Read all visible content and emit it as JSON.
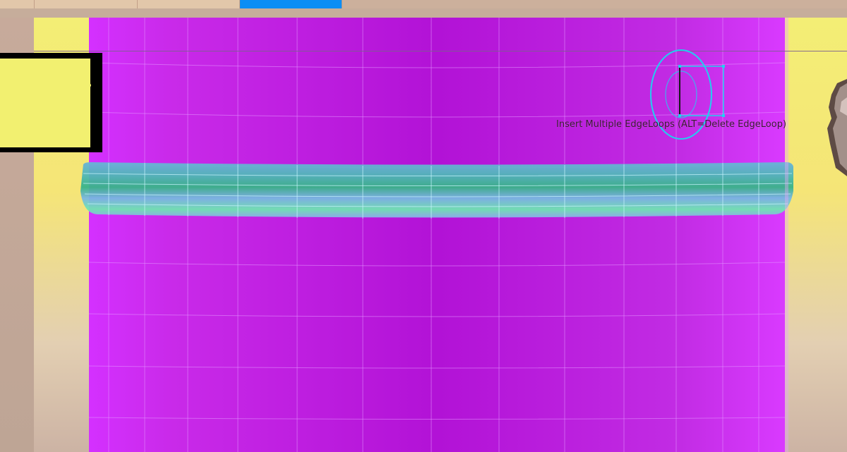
{
  "tabs": [
    {
      "label": "",
      "active": false
    },
    {
      "label": "",
      "active": false
    },
    {
      "label": "",
      "active": false
    },
    {
      "label": "",
      "active": true
    }
  ],
  "tooltip": {
    "text": "Insert Multiple EdgeLoops (ALT=Delete EdgeLoop)"
  },
  "colors": {
    "mesh": "#c01fe0",
    "edge_loop_band": "#5fd0a0",
    "active_tab": "#0b8ef5",
    "gizmo": "#21d0f0",
    "viewport_bg": "#f3ee75"
  },
  "icons": {
    "tool_gizmo": "edgeloop-tool-icon",
    "avatar": "head-figure-icon"
  }
}
